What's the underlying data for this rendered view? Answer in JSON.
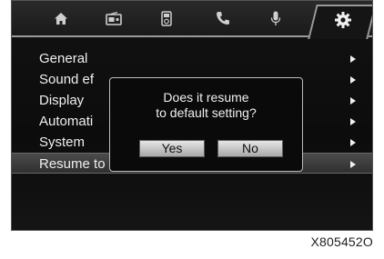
{
  "tabs": [
    {
      "icon": "home-icon"
    },
    {
      "icon": "radio-icon"
    },
    {
      "icon": "media-icon"
    },
    {
      "icon": "phone-icon"
    },
    {
      "icon": "microphone-icon"
    },
    {
      "icon": "gear-icon",
      "active": true
    }
  ],
  "menu": {
    "items": [
      {
        "label": "General"
      },
      {
        "label": "Sound ef"
      },
      {
        "label": "Display"
      },
      {
        "label": "Automati"
      },
      {
        "label": "System"
      },
      {
        "label": "Resume to factory setting",
        "selected": true
      }
    ]
  },
  "dialog": {
    "line1": "Does it resume",
    "line2": "to default setting?",
    "yes_label": "Yes",
    "no_label": "No"
  },
  "caption": "X805452O",
  "colors": {
    "screen_bg": "#0c0c0c",
    "text": "#f0f0f0",
    "selected_bg": "#3d3d3d",
    "button_bg": "#d0d0d0"
  }
}
